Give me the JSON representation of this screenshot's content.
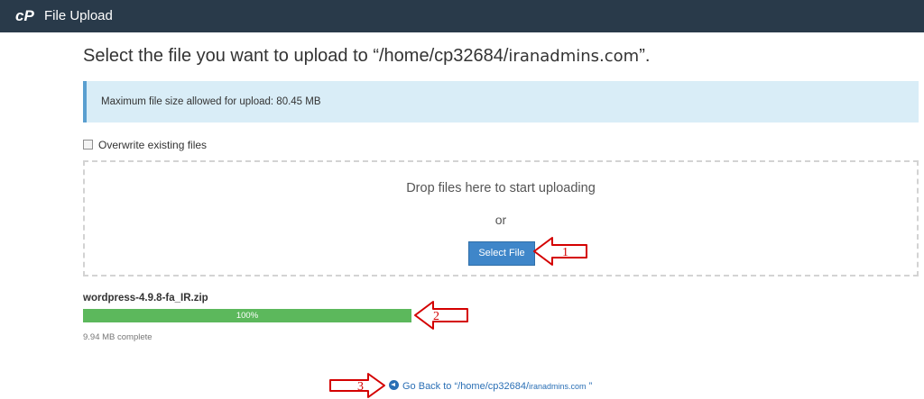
{
  "header": {
    "logo_icon": "cpanel-logo",
    "title": "File Upload"
  },
  "main": {
    "heading_prefix": "Select the file you want to upload to “/home/cp32684/",
    "heading_domain": "iranadmins.com",
    "heading_suffix": "”.",
    "max_size_notice": "Maximum file size allowed for upload: 80.45 MB",
    "overwrite_label": "Overwrite existing files",
    "overwrite_checked": false
  },
  "dropzone": {
    "prompt": "Drop files here to start uploading",
    "or_text": "or",
    "select_button": "Select File"
  },
  "upload": {
    "filename": "wordpress-4.9.8-fa_IR.zip",
    "progress_label": "100%",
    "progress_fraction": 1.0,
    "status": "9.94 MB complete"
  },
  "back": {
    "icon": "circle-arrow-left-icon",
    "prefix": "Go Back to “/home/cp32684/",
    "domain": "iranadmins.com",
    "suffix": " ”"
  },
  "annotations": {
    "arrow1": "1",
    "arrow2": "2",
    "arrow3": "3",
    "arrow_color": "#d40000"
  },
  "colors": {
    "topbar": "#293a4a",
    "alert_bg": "#d9edf7",
    "primary": "#3f86c9",
    "success": "#5cb85c",
    "link": "#2a6fb5"
  }
}
